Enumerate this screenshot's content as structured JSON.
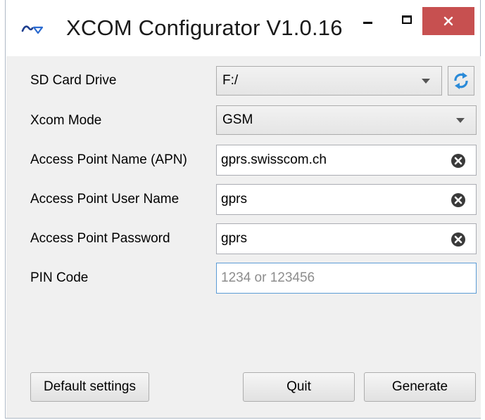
{
  "window": {
    "title": "XCOM Configurator V1.0.16",
    "close_color": "#c75050"
  },
  "form": {
    "sd_card_drive": {
      "label": "SD Card Drive",
      "value": "F:/"
    },
    "xcom_mode": {
      "label": "Xcom Mode",
      "value": "GSM"
    },
    "apn": {
      "label": "Access Point Name (APN)",
      "value": "gprs.swisscom.ch"
    },
    "ap_user": {
      "label": "Access Point User Name",
      "value": "gprs"
    },
    "ap_password": {
      "label": "Access Point Password",
      "value": "gprs"
    },
    "pin": {
      "label": "PIN Code",
      "value": "",
      "placeholder": "1234 or 123456"
    }
  },
  "buttons": {
    "default_settings": "Default settings",
    "quit": "Quit",
    "generate": "Generate"
  },
  "icons": {
    "app": "app-logo-icon",
    "refresh": "refresh-icon",
    "clear": "clear-icon",
    "dropdown": "chevron-down-icon"
  }
}
